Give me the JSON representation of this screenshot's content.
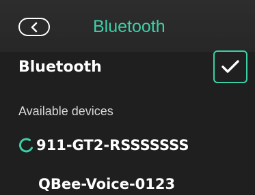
{
  "header": {
    "title": "Bluetooth",
    "back_icon": "chevron-left-icon",
    "title_color": "#3dd0a8"
  },
  "bluetooth_setting": {
    "label": "Bluetooth",
    "enabled": true,
    "checkbox_icon": "check-icon",
    "accent_color": "#3dd0a8"
  },
  "devices": {
    "section_label": "Available devices",
    "items": [
      {
        "name": "911-GT2-RSSSSSSS",
        "status_icon": "loading-spinner-icon",
        "connecting": true
      },
      {
        "name": "QBee-Voice-0123",
        "connecting": false
      }
    ]
  }
}
